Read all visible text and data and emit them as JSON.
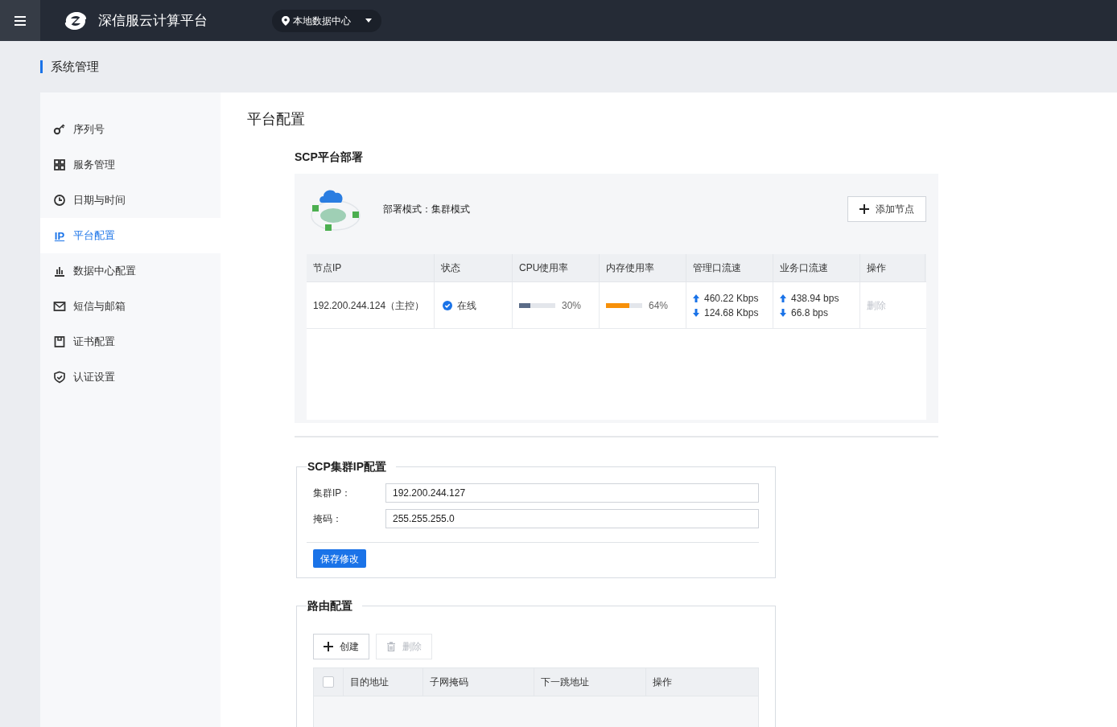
{
  "header": {
    "title": "深信服云计算平台",
    "datacenter": "本地数据中心"
  },
  "breadcrumb": "系统管理",
  "sidebar": {
    "items": [
      {
        "label": "序列号",
        "selected": false
      },
      {
        "label": "服务管理",
        "selected": false
      },
      {
        "label": "日期与时间",
        "selected": false
      },
      {
        "label": "平台配置",
        "glyph": "IP",
        "selected": true
      },
      {
        "label": "数据中心配置",
        "selected": false
      },
      {
        "label": "短信与邮箱",
        "selected": false
      },
      {
        "label": "证书配置",
        "selected": false
      },
      {
        "label": "认证设置",
        "selected": false
      }
    ]
  },
  "page_title": "平台配置",
  "deployment": {
    "title": "SCP平台部署",
    "mode": "部署模式：集群模式",
    "add_button": "添加节点",
    "columns": [
      "节点IP",
      "状态",
      "CPU使用率",
      "内存使用率",
      "管理口流速",
      "业务口流速",
      "操作"
    ],
    "rows": [
      {
        "ip": "192.200.244.124（主控）",
        "status": {
          "text": "在线",
          "online": true
        },
        "cpu": {
          "level": 0.3,
          "reading": "30%"
        },
        "memory": {
          "level": 0.64,
          "reading": "64%"
        },
        "mgmt": {
          "up": "460.22 Kbps",
          "down": "124.68 Kbps"
        },
        "service": {
          "up": "438.94 bps",
          "down": "66.8 bps"
        },
        "action": {
          "text": "删除",
          "disabled": true
        }
      }
    ]
  },
  "cluster": {
    "title": "SCP集群IP配置",
    "fields": [
      {
        "label": "集群IP：",
        "value": "192.200.244.127"
      },
      {
        "label": "掩码：",
        "value": "255.255.255.0"
      }
    ],
    "save_button": "保存修改"
  },
  "routes": {
    "title": "路由配置",
    "create_button": {
      "text": "创建",
      "disabled": false
    },
    "delete_button": {
      "text": "删除",
      "disabled": true
    },
    "header_checkbox": {
      "checked": false
    },
    "columns": [
      "目的地址",
      "子网掩码",
      "下一跳地址",
      "操作"
    ]
  }
}
